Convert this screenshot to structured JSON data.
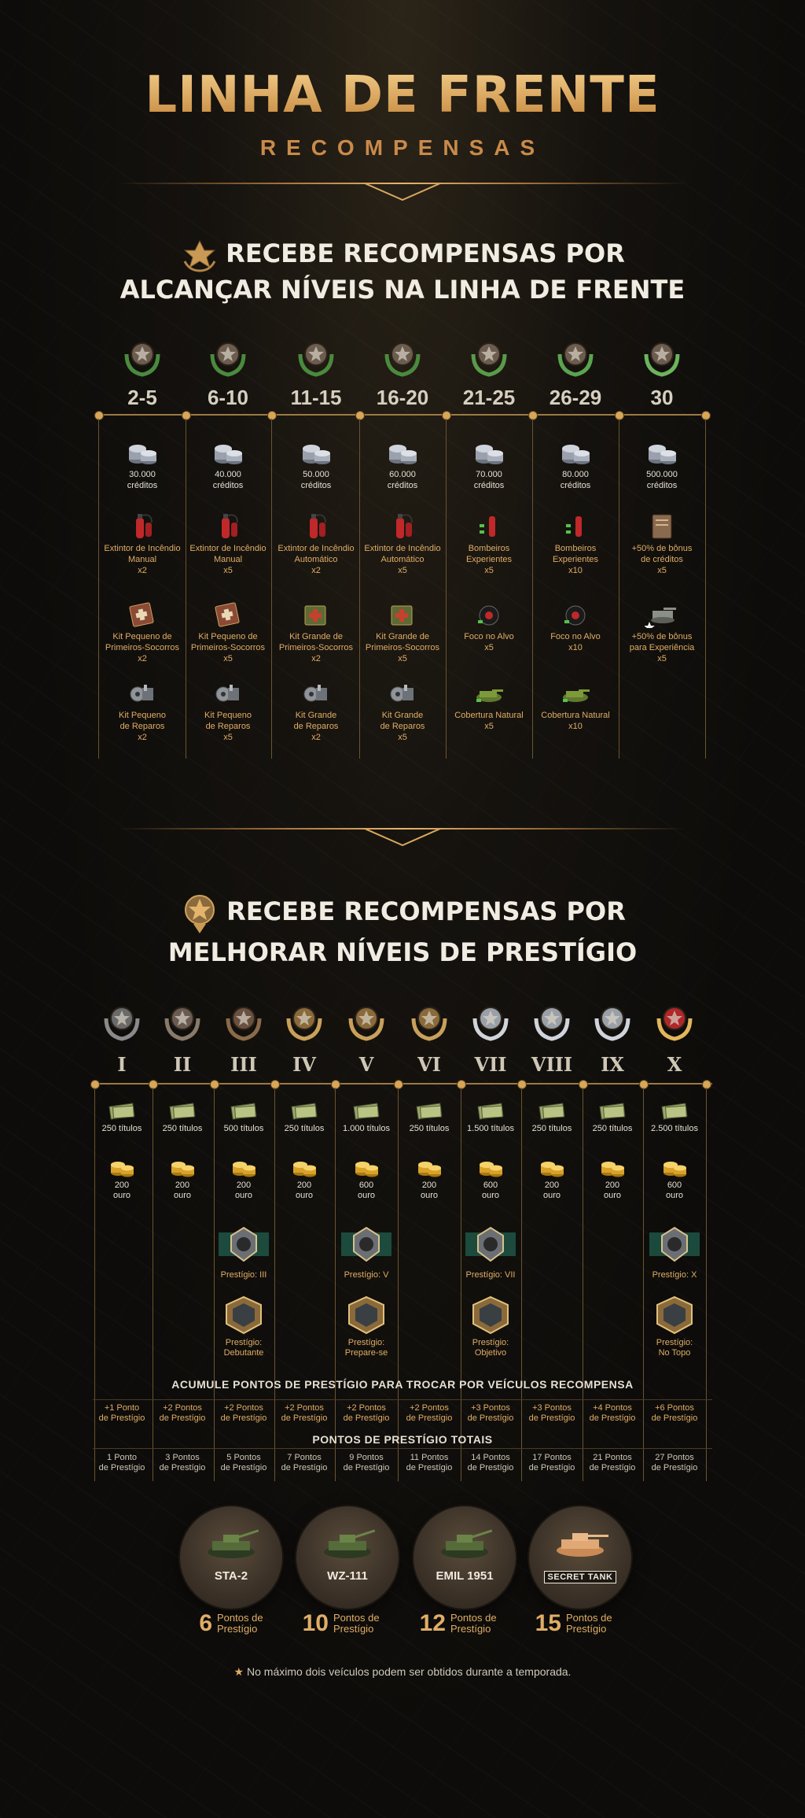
{
  "header": {
    "title": "LINHA DE FRENTE",
    "subtitle": "RECOMPENSAS"
  },
  "section1": {
    "title_line1": "RECEBE RECOMPENSAS POR",
    "title_line2": "ALCANÇAR NÍVEIS NA LINHA DE FRENTE",
    "columns": [
      {
        "level": "2-5",
        "credits": "30.000",
        "credits_unit": "créditos",
        "ext": "Extintor de Incêndio\nManual",
        "ext_qty": "x2",
        "kit": "Kit Pequeno de\nPrimeiros-Socorros",
        "kit_qty": "x2",
        "rep": "Kit Pequeno\nde Reparos",
        "rep_qty": "x2"
      },
      {
        "level": "6-10",
        "credits": "40.000",
        "credits_unit": "créditos",
        "ext": "Extintor de Incêndio\nManual",
        "ext_qty": "x5",
        "kit": "Kit Pequeno de\nPrimeiros-Socorros",
        "kit_qty": "x5",
        "rep": "Kit Pequeno\nde Reparos",
        "rep_qty": "x5"
      },
      {
        "level": "11-15",
        "credits": "50.000",
        "credits_unit": "créditos",
        "ext": "Extintor de Incêndio\nAutomático",
        "ext_qty": "x2",
        "kit": "Kit Grande de\nPrimeiros-Socorros",
        "kit_qty": "x2",
        "rep": "Kit Grande\nde Reparos",
        "rep_qty": "x2"
      },
      {
        "level": "16-20",
        "credits": "60.000",
        "credits_unit": "créditos",
        "ext": "Extintor de Incêndio\nAutomático",
        "ext_qty": "x5",
        "kit": "Kit Grande de\nPrimeiros-Socorros",
        "kit_qty": "x5",
        "rep": "Kit Grande\nde Reparos",
        "rep_qty": "x5"
      },
      {
        "level": "21-25",
        "credits": "70.000",
        "credits_unit": "créditos",
        "ext": "Bombeiros\nExperientes",
        "ext_qty": "x5",
        "kit": "Foco no Alvo",
        "kit_qty": "x5",
        "rep": "Cobertura Natural",
        "rep_qty": "x5"
      },
      {
        "level": "26-29",
        "credits": "80.000",
        "credits_unit": "créditos",
        "ext": "Bombeiros\nExperientes",
        "ext_qty": "x10",
        "kit": "Foco no Alvo",
        "kit_qty": "x10",
        "rep": "Cobertura Natural",
        "rep_qty": "x10"
      },
      {
        "level": "30",
        "credits": "500.000",
        "credits_unit": "créditos",
        "ext": "+50% de bônus\nde créditos",
        "ext_qty": "x5",
        "kit": "+50% de bônus\npara Experiência",
        "kit_qty": "x5",
        "rep": "",
        "rep_qty": ""
      }
    ]
  },
  "section2": {
    "title_line1": "RECEBE RECOMPENSAS POR",
    "title_line2": "MELHORAR NÍVEIS DE PRESTÍGIO",
    "columns": [
      {
        "rank": "I",
        "bonds": "250 títulos",
        "gold": "200",
        "gold_unit": "ouro",
        "emblem": "",
        "style": "",
        "points": "+1 Ponto\nde Prestígio",
        "total": "1 Ponto\nde Prestígio"
      },
      {
        "rank": "II",
        "bonds": "250 títulos",
        "gold": "200",
        "gold_unit": "ouro",
        "emblem": "",
        "style": "",
        "points": "+2 Pontos\nde Prestígio",
        "total": "3 Pontos\nde Prestígio"
      },
      {
        "rank": "III",
        "bonds": "500 títulos",
        "gold": "200",
        "gold_unit": "ouro",
        "emblem": "Prestígio: III",
        "style": "Prestígio:\nDebutante",
        "points": "+2 Pontos\nde Prestígio",
        "total": "5 Pontos\nde Prestígio"
      },
      {
        "rank": "IV",
        "bonds": "250 títulos",
        "gold": "200",
        "gold_unit": "ouro",
        "emblem": "",
        "style": "",
        "points": "+2 Pontos\nde Prestígio",
        "total": "7 Pontos\nde Prestígio"
      },
      {
        "rank": "V",
        "bonds": "1.000 títulos",
        "gold": "600",
        "gold_unit": "ouro",
        "emblem": "Prestígio: V",
        "style": "Prestígio:\nPrepare-se",
        "points": "+2 Pontos\nde Prestígio",
        "total": "9 Pontos\nde Prestígio"
      },
      {
        "rank": "VI",
        "bonds": "250 títulos",
        "gold": "200",
        "gold_unit": "ouro",
        "emblem": "",
        "style": "",
        "points": "+2 Pontos\nde Prestígio",
        "total": "11 Pontos\nde Prestígio"
      },
      {
        "rank": "VII",
        "bonds": "1.500 títulos",
        "gold": "600",
        "gold_unit": "ouro",
        "emblem": "Prestígio: VII",
        "style": "Prestígio:\nObjetivo",
        "points": "+3 Pontos\nde Prestígio",
        "total": "14 Pontos\nde Prestígio"
      },
      {
        "rank": "VIII",
        "bonds": "250 títulos",
        "gold": "200",
        "gold_unit": "ouro",
        "emblem": "",
        "style": "",
        "points": "+3 Pontos\nde Prestígio",
        "total": "17 Pontos\nde Prestígio"
      },
      {
        "rank": "IX",
        "bonds": "250 títulos",
        "gold": "200",
        "gold_unit": "ouro",
        "emblem": "",
        "style": "",
        "points": "+4 Pontos\nde Prestígio",
        "total": "21 Pontos\nde Prestígio"
      },
      {
        "rank": "X",
        "bonds": "2.500 títulos",
        "gold": "600",
        "gold_unit": "ouro",
        "emblem": "Prestígio: X",
        "style": "Prestígio:\nNo Topo",
        "points": "+6 Pontos\nde Prestígio",
        "total": "27 Pontos\nde Prestígio"
      }
    ],
    "band1": "ACUMULE PONTOS DE PRESTÍGIO PARA TROCAR POR VEÍCULOS RECOMPENSA",
    "band2": "PONTOS DE PRESTÍGIO TOTAIS"
  },
  "vehicles": [
    {
      "name": "STA-2",
      "points": "6",
      "points_label": "Pontos de\nPrestígio"
    },
    {
      "name": "WZ-111",
      "points": "10",
      "points_label": "Pontos de\nPrestígio"
    },
    {
      "name": "EMIL 1951",
      "points": "12",
      "points_label": "Pontos de\nPrestígio"
    },
    {
      "name": "SECRET TANK",
      "points": "15",
      "points_label": "Pontos de\nPrestígio"
    }
  ],
  "footnote": "No máximo dois veículos podem ser obtidos durante a temporada.",
  "colors": {
    "accent": "#e0ad66",
    "line": "#9c7a43",
    "text": "#e6e0d3"
  }
}
